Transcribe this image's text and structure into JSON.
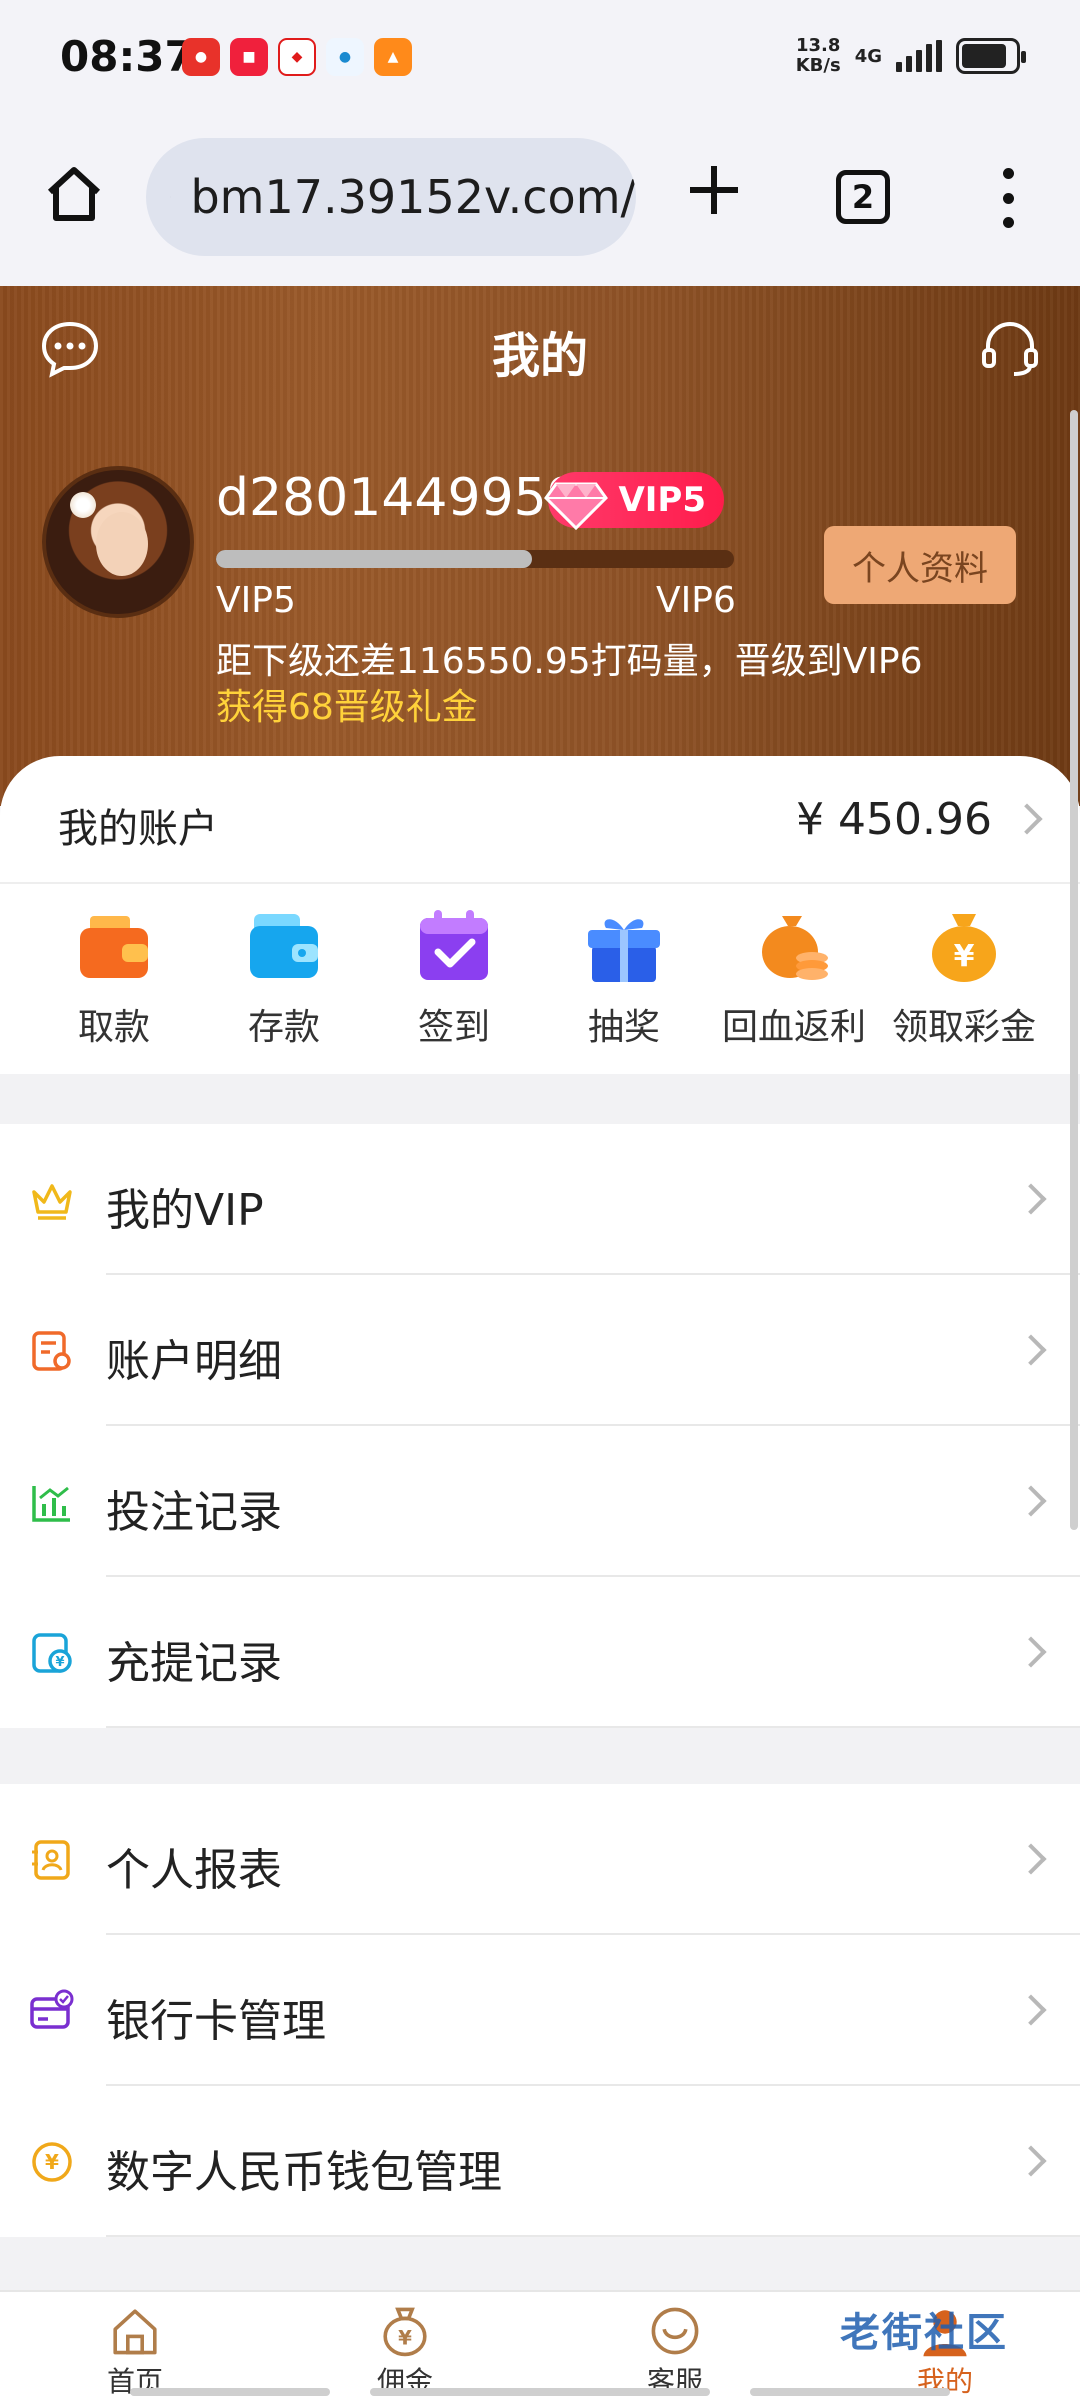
{
  "status_bar": {
    "time": "08:37",
    "net_speed_value": "13.8",
    "net_speed_unit": "KB/s",
    "net_type": "4G"
  },
  "browser": {
    "url": "bm17.39152v.com/",
    "tab_count": "2"
  },
  "header": {
    "title": "我的",
    "username": "d2801449959",
    "vip_badge": "VIP5",
    "level_current": "VIP5",
    "level_next": "VIP6",
    "progress": 0.61,
    "profile_button": "个人资料",
    "upgrade_hint": "距下级还差116550.95打码量，晋级到VIP6",
    "upgrade_gift": "获得68晋级礼金"
  },
  "account": {
    "label": "我的账户",
    "balance": "¥ 450.96"
  },
  "quick_actions": [
    {
      "label": "取款",
      "icon": "wallet-icon",
      "color": "#f56a1f"
    },
    {
      "label": "存款",
      "icon": "wallet-card-icon",
      "color": "#16a6ee"
    },
    {
      "label": "签到",
      "icon": "calendar-check-icon",
      "color": "#8b3ff0"
    },
    {
      "label": "抽奖",
      "icon": "gift-box-icon",
      "color": "#2a5fe8"
    },
    {
      "label": "回血返利",
      "icon": "money-bag-coins-icon",
      "color": "#f38a1e"
    },
    {
      "label": "领取彩金",
      "icon": "money-bag-yen-icon",
      "color": "#f7a51b"
    }
  ],
  "menu_group_1": [
    {
      "label": "我的VIP",
      "icon": "crown-icon",
      "color": "#f0b81a"
    },
    {
      "label": "账户明细",
      "icon": "document-list-icon",
      "color": "#f06a2a"
    },
    {
      "label": "投注记录",
      "icon": "bar-chart-icon",
      "color": "#2fbd4a"
    },
    {
      "label": "充提记录",
      "icon": "yen-transfer-icon",
      "color": "#1aa4d8"
    }
  ],
  "menu_group_2": [
    {
      "label": "个人报表",
      "icon": "report-icon",
      "color": "#f0a81a"
    },
    {
      "label": "银行卡管理",
      "icon": "bank-card-icon",
      "color": "#7a2fd0"
    },
    {
      "label": "数字人民币钱包管理",
      "icon": "digital-yuan-icon",
      "color": "#f0a81a"
    }
  ],
  "bottom_nav": [
    {
      "label": "首页",
      "icon": "home-icon"
    },
    {
      "label": "佣金",
      "icon": "commission-bag-icon"
    },
    {
      "label": "客服",
      "icon": "headset-icon"
    },
    {
      "label": "我的",
      "icon": "profile-icon"
    }
  ],
  "watermark": "老街社区"
}
